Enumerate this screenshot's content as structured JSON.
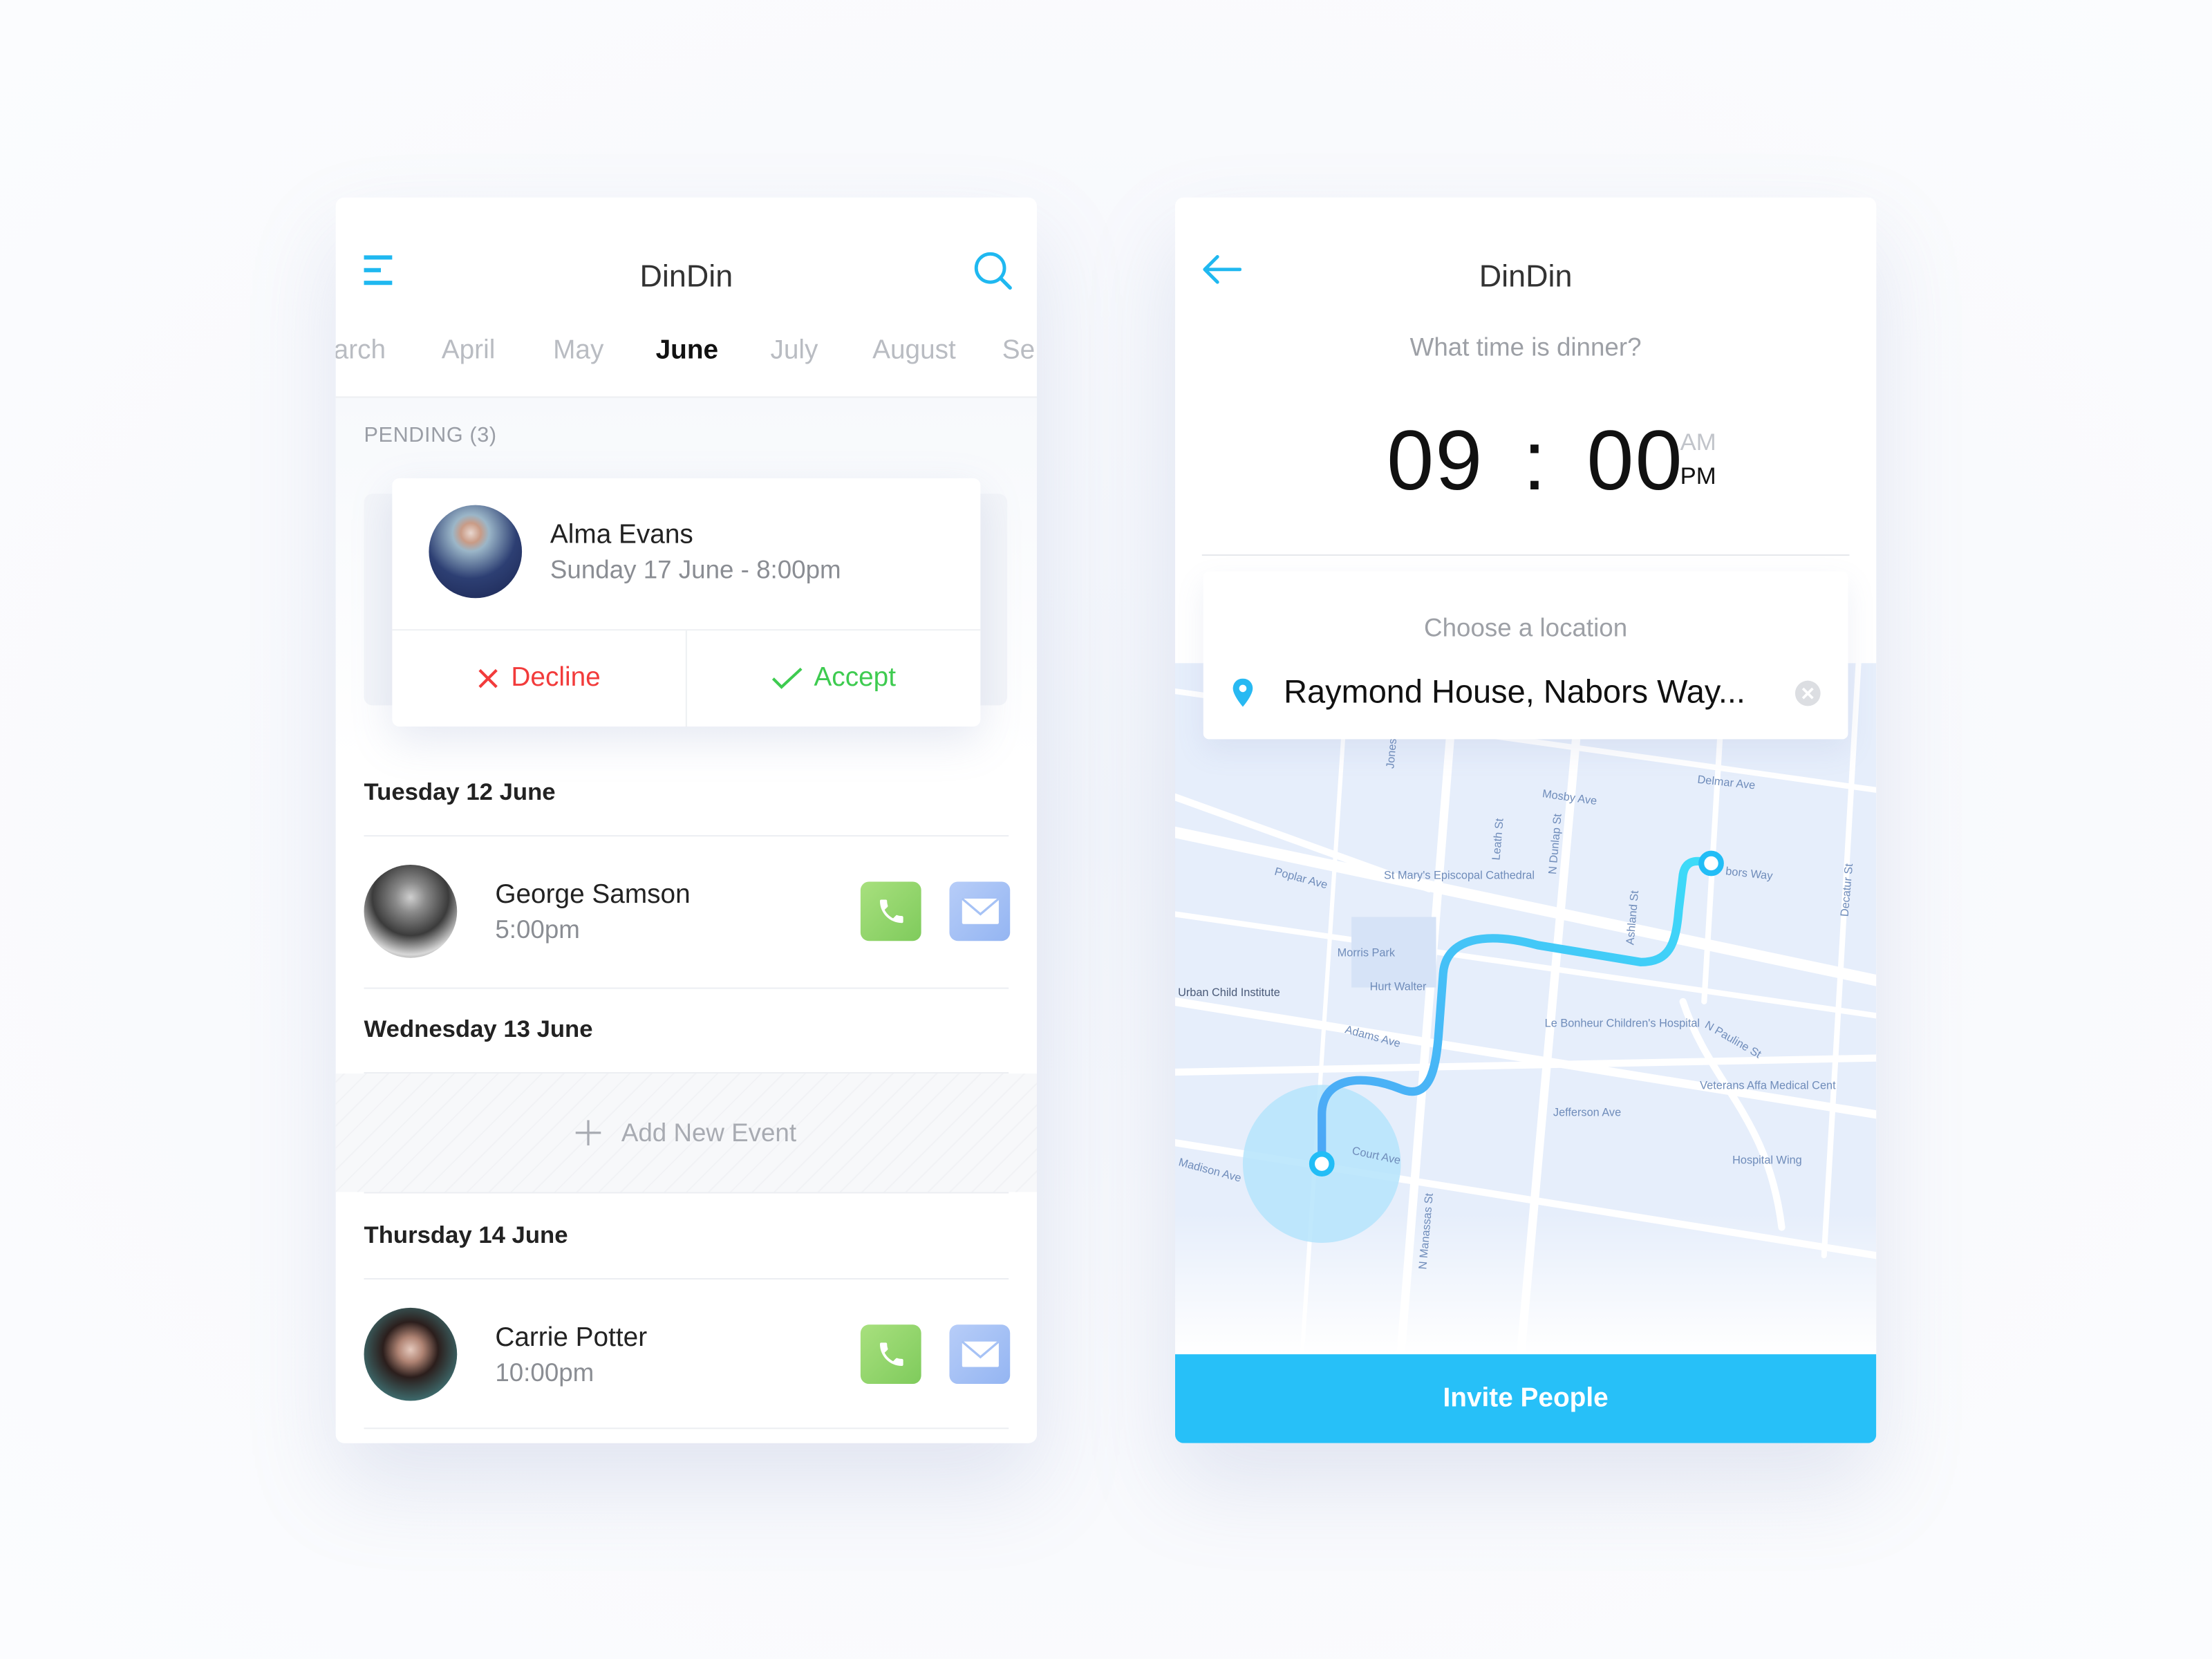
{
  "left_screen": {
    "title": "DinDin",
    "months": [
      "arch",
      "April",
      "May",
      "June",
      "July",
      "August",
      "Se"
    ],
    "active_month": "June",
    "pending_label": "PENDING (3)",
    "pending_card": {
      "name": "Alma Evans",
      "datetime": "Sunday 17 June - 8:00pm",
      "decline_label": "Decline",
      "accept_label": "Accept"
    },
    "days": [
      {
        "heading": "Tuesday 12 June",
        "name": "George Samson",
        "time": "5:00pm"
      },
      {
        "heading": "Wednesday 13 June",
        "add_label": "Add New Event"
      },
      {
        "heading": "Thursday 14 June",
        "name": "Carrie Potter",
        "time": "10:00pm"
      }
    ],
    "colors": {
      "accent": "#1fb8f0",
      "decline": "#f23b3b",
      "accept": "#3ecb50",
      "call": "#8fd468",
      "mail": "#a6c2f5"
    }
  },
  "right_screen": {
    "title": "DinDin",
    "question": "What time is dinner?",
    "time": {
      "hours": "09",
      "separator": ":",
      "minutes": "00",
      "am": "AM",
      "pm": "PM",
      "selected": "PM"
    },
    "location": {
      "label": "Choose a location",
      "value": "Raymond House, Nabors Way..."
    },
    "map_labels": [
      "Poplar Ave",
      "St Mary's Episcopal Cathedral",
      "Morris Park",
      "Hurt Walter",
      "Urban Child Institute",
      "Adams Ave",
      "Le Bonheur Children's Hospital",
      "N Pauline St",
      "Veterans Affa Medical Cent",
      "Jefferson Ave",
      "Court Ave",
      "Madison Ave",
      "Mosby Ave",
      "Delmar Ave",
      "Hospital Wing",
      "N Dunlap St",
      "N Manassas St",
      "Jones St",
      "Leath St",
      "Ashland St",
      "Decatur St",
      "bors Way"
    ],
    "invite_label": "Invite People",
    "colors": {
      "accent": "#27c0f8",
      "route_start": "#4da6f6",
      "route_end": "#3ddcf8"
    }
  }
}
